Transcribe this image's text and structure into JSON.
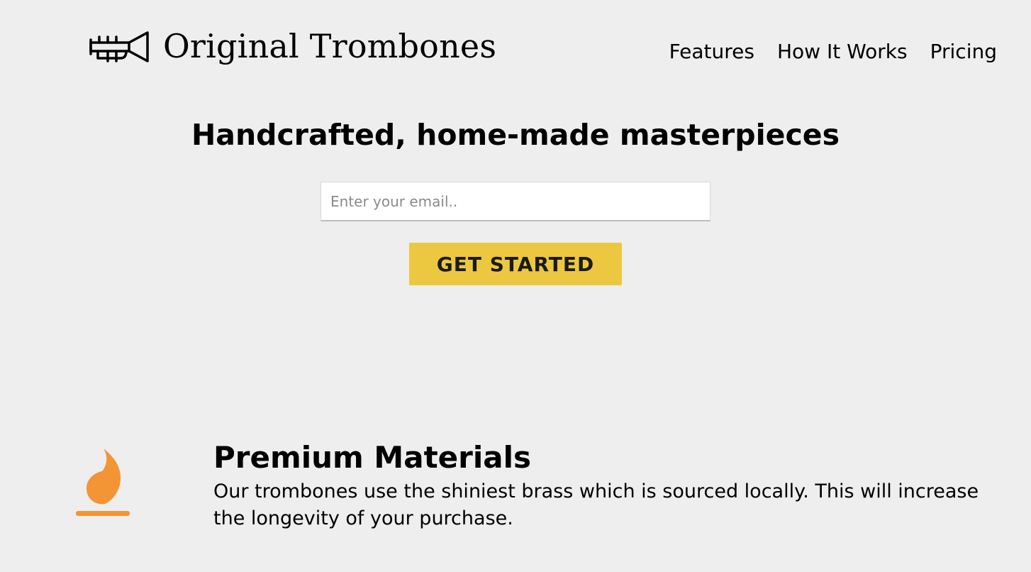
{
  "header": {
    "logo_icon": "trumpet-icon",
    "brand": "Original Trombones",
    "nav": [
      "Features",
      "How It Works",
      "Pricing"
    ]
  },
  "hero": {
    "title": "Handcrafted, home-made masterpieces",
    "email_placeholder": "Enter your email..",
    "cta_label": "GET STARTED",
    "cta_color": "#ebc83f"
  },
  "features": [
    {
      "icon": "fire-icon",
      "icon_color": "#f39534",
      "title": "Premium Materials",
      "text": "Our trombones use the shiniest brass which is sourced locally. This will increase the longevity of your purchase."
    }
  ]
}
